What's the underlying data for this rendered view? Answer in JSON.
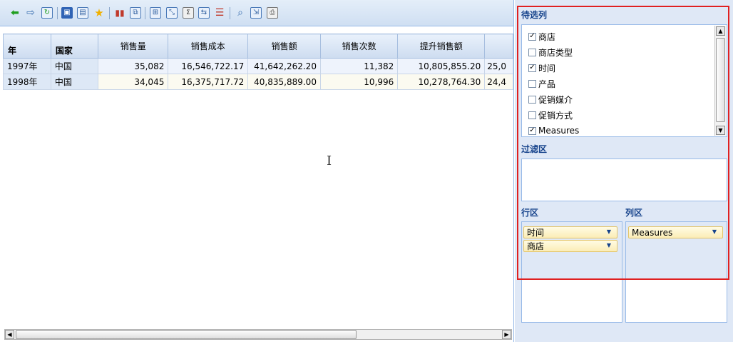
{
  "table": {
    "row_headers": [
      "年",
      "国家"
    ],
    "columns": [
      "销售量",
      "销售成本",
      "销售额",
      "销售次数",
      "提升销售额",
      ""
    ],
    "rows": [
      {
        "year": "1997年",
        "country": "中国",
        "values": [
          "35,082",
          "16,546,722.17",
          "41,642,262.20",
          "11,382",
          "10,805,855.20",
          "25,0"
        ]
      },
      {
        "year": "1998年",
        "country": "中国",
        "values": [
          "34,045",
          "16,375,717.72",
          "40,835,889.00",
          "10,996",
          "10,278,764.30",
          "24,4"
        ]
      }
    ]
  },
  "right_panel": {
    "candidates_title": "待选列",
    "candidates": [
      {
        "label": "商店",
        "checked": true
      },
      {
        "label": "商店类型",
        "checked": false
      },
      {
        "label": "时间",
        "checked": true
      },
      {
        "label": "产品",
        "checked": false
      },
      {
        "label": "促销媒介",
        "checked": false
      },
      {
        "label": "促销方式",
        "checked": false
      },
      {
        "label": "Measures",
        "checked": true
      }
    ],
    "filter_title": "过滤区",
    "row_title": "行区",
    "row_fields": [
      "时间",
      "商店"
    ],
    "col_title": "列区",
    "col_fields": [
      "Measures"
    ]
  },
  "icons": {
    "toolbar": [
      "back-arrow-icon",
      "forward-arrow-icon",
      "refresh-icon",
      "save-icon",
      "save-as-icon",
      "favorite-star-icon",
      "chart-icon",
      "export-icon",
      "filter-icon",
      "drill-icon",
      "sum-icon",
      "swap-axes-icon",
      "sort-icon",
      "zoom-icon",
      "properties-icon",
      "print-icon"
    ]
  },
  "colors": {
    "highlight_frame": "#e02020",
    "panel_title": "#15428b",
    "field_pill": "#fbedb6"
  }
}
